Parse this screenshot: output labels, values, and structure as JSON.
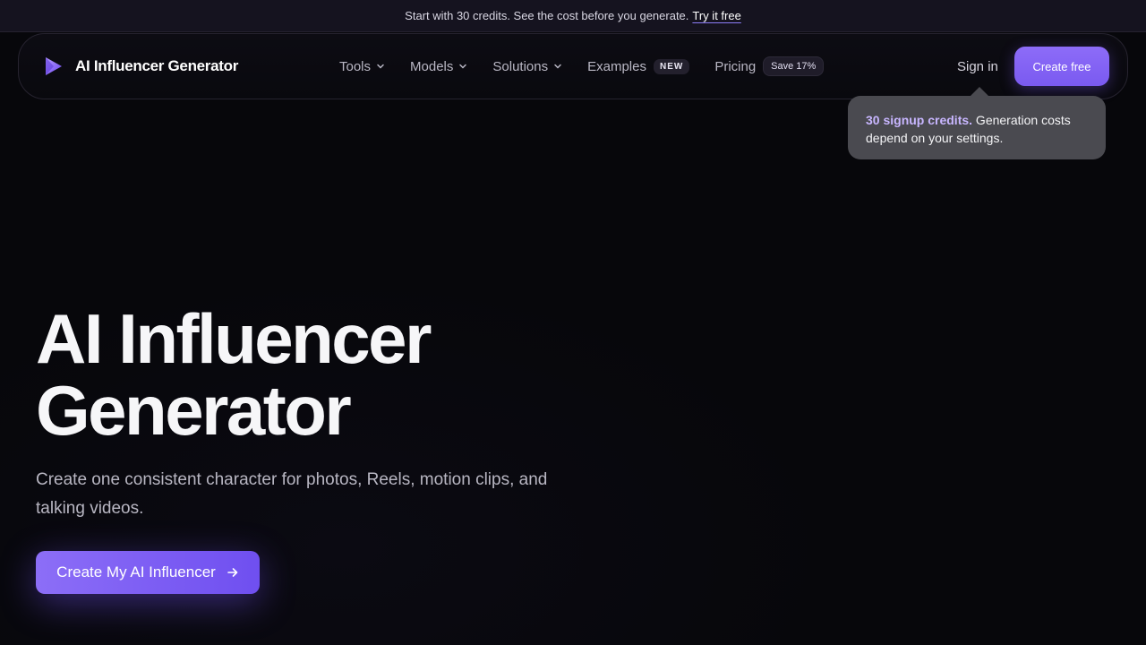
{
  "announcement": {
    "text": "Start with 30 credits. See the cost before you generate.",
    "link": "Try it free"
  },
  "brand": {
    "name": "AI Influencer Generator",
    "logo_icon": "play-logo-icon"
  },
  "nav": {
    "items": [
      {
        "label": "Tools",
        "icon": "chevron-down-icon"
      },
      {
        "label": "Models",
        "icon": "chevron-down-icon"
      },
      {
        "label": "Solutions",
        "icon": "chevron-down-icon"
      },
      {
        "label": "Examples",
        "badge": "NEW"
      },
      {
        "label": "Pricing",
        "badge": "Save 17%"
      }
    ],
    "signin": "Sign in",
    "create_free": "Create free"
  },
  "tooltip": {
    "highlight": "30 signup credits.",
    "text": " Generation costs depend on your settings."
  },
  "hero": {
    "title_line1": "AI Influencer",
    "title_line2": "Generator",
    "subtitle": "Create one consistent character for photos, Reels, motion clips, and talking videos.",
    "cta": "Create My AI Influencer",
    "cta_icon": "arrow-right-icon"
  },
  "colors": {
    "accent": "#7c5cf3",
    "background": "#07070b",
    "tooltip_bg": "#4a4a50",
    "tooltip_highlight": "#c8b6ff"
  }
}
